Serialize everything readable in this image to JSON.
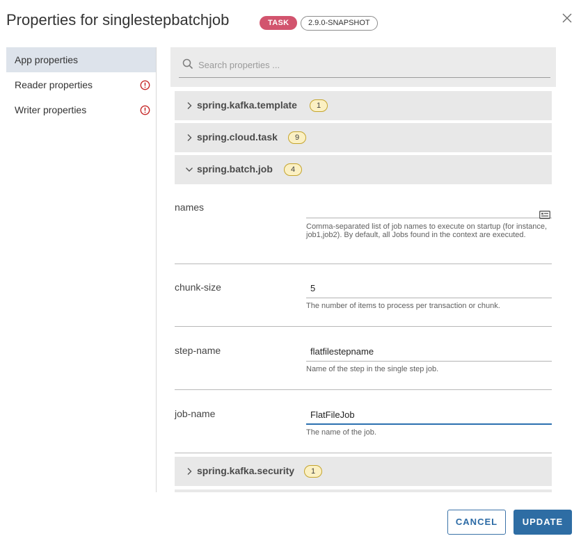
{
  "dialog": {
    "title": "Properties for singlestepbatchjob",
    "type_badge": "TASK",
    "version_badge": "2.9.0-SNAPSHOT"
  },
  "sidebar": {
    "items": [
      {
        "label": "App properties",
        "active": true,
        "error": false
      },
      {
        "label": "Reader properties",
        "active": false,
        "error": true
      },
      {
        "label": "Writer properties",
        "active": false,
        "error": true
      }
    ]
  },
  "search": {
    "placeholder": "Search properties ..."
  },
  "groups": {
    "kafka_template": {
      "name": "spring.kafka.template",
      "count": "1",
      "expanded": false
    },
    "cloud_task": {
      "name": "spring.cloud.task",
      "count": "9",
      "expanded": false
    },
    "batch_job": {
      "name": "spring.batch.job",
      "count": "4",
      "expanded": true
    },
    "kafka_security": {
      "name": "spring.kafka.security",
      "count": "1",
      "expanded": false
    }
  },
  "properties": {
    "names": {
      "name": "names",
      "value": "",
      "description": "Comma-separated list of job names to execute on startup (for instance, job1,job2). By default, all Jobs found in the context are executed."
    },
    "chunk_size": {
      "name": "chunk-size",
      "value": "5",
      "description": "The number of items to process per transaction or chunk."
    },
    "step_name": {
      "name": "step-name",
      "value": "flatfilestepname",
      "description": "Name of the step in the single step job."
    },
    "job_name": {
      "name": "job-name",
      "value": "FlatFileJob",
      "description": "The name of the job."
    }
  },
  "footer": {
    "cancel_label": "CANCEL",
    "update_label": "UPDATE"
  },
  "colors": {
    "task_badge": "#d2546e",
    "count_badge_bg": "#fbf0c3",
    "primary": "#2e6da4",
    "error": "#c62828",
    "active_nav": "#dde3eb"
  },
  "icons": {
    "close": "close-icon",
    "search": "search-icon",
    "error": "error-icon",
    "chevron_right": "chevron-right-icon",
    "chevron_down": "chevron-down-icon",
    "edit_list": "list-card-icon"
  }
}
